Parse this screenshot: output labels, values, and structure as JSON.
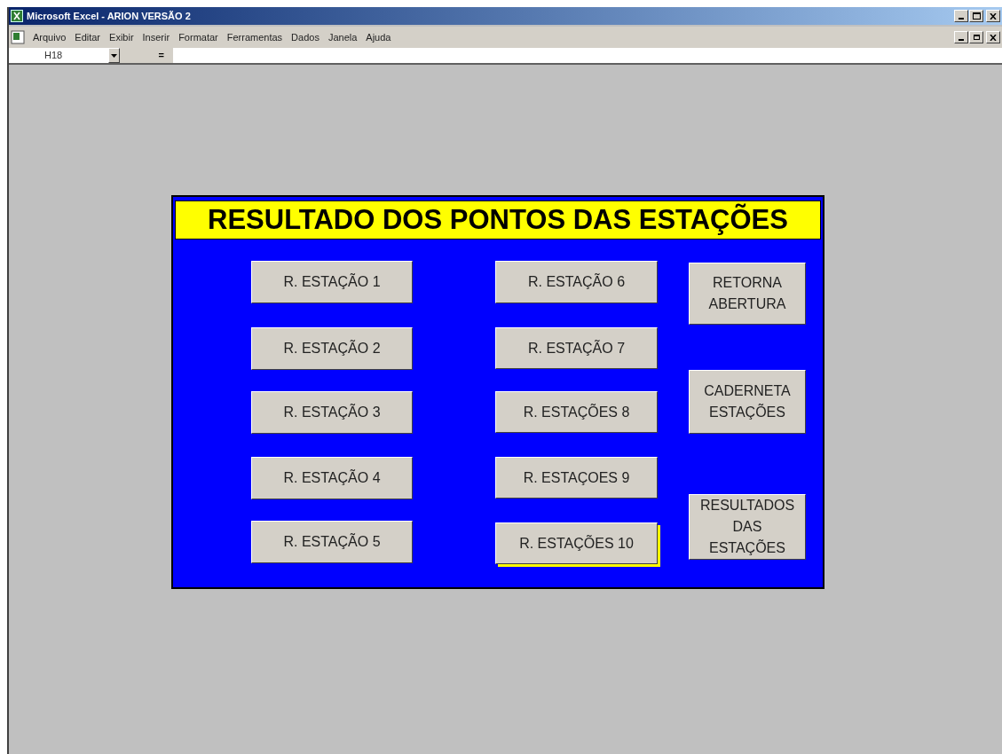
{
  "window": {
    "title": "Microsoft Excel - ARION VERSÃO 2"
  },
  "menu": [
    "Arquivo",
    "Editar",
    "Exibir",
    "Inserir",
    "Formatar",
    "Ferramentas",
    "Dados",
    "Janela",
    "Ajuda"
  ],
  "formula_bar": {
    "name_box": "H18",
    "equals": "="
  },
  "panel": {
    "title": "RESULTADO DOS PONTOS DAS ESTAÇÕES",
    "buttons": [
      {
        "label": "R. ESTAÇÃO 1",
        "selected": false
      },
      {
        "label": "R. ESTAÇÃO 2",
        "selected": false
      },
      {
        "label": "R. ESTAÇÃO 3",
        "selected": false
      },
      {
        "label": "R. ESTAÇÃO 4",
        "selected": false
      },
      {
        "label": "R. ESTAÇÃO 5",
        "selected": false
      },
      {
        "label": "R. ESTAÇÃO 6",
        "selected": false
      },
      {
        "label": "R. ESTAÇÃO 7",
        "selected": false
      },
      {
        "label": "R. ESTAÇÕES 8",
        "selected": false
      },
      {
        "label": "R. ESTAÇOES 9",
        "selected": false
      },
      {
        "label": "R. ESTAÇÕES 10",
        "selected": true
      },
      {
        "label": "RETORNA ABERTURA",
        "selected": false
      },
      {
        "label": "CADERNETA ESTAÇÕES",
        "selected": false
      },
      {
        "label": "RESULTADOS DAS ESTAÇÕES",
        "selected": false
      }
    ]
  }
}
